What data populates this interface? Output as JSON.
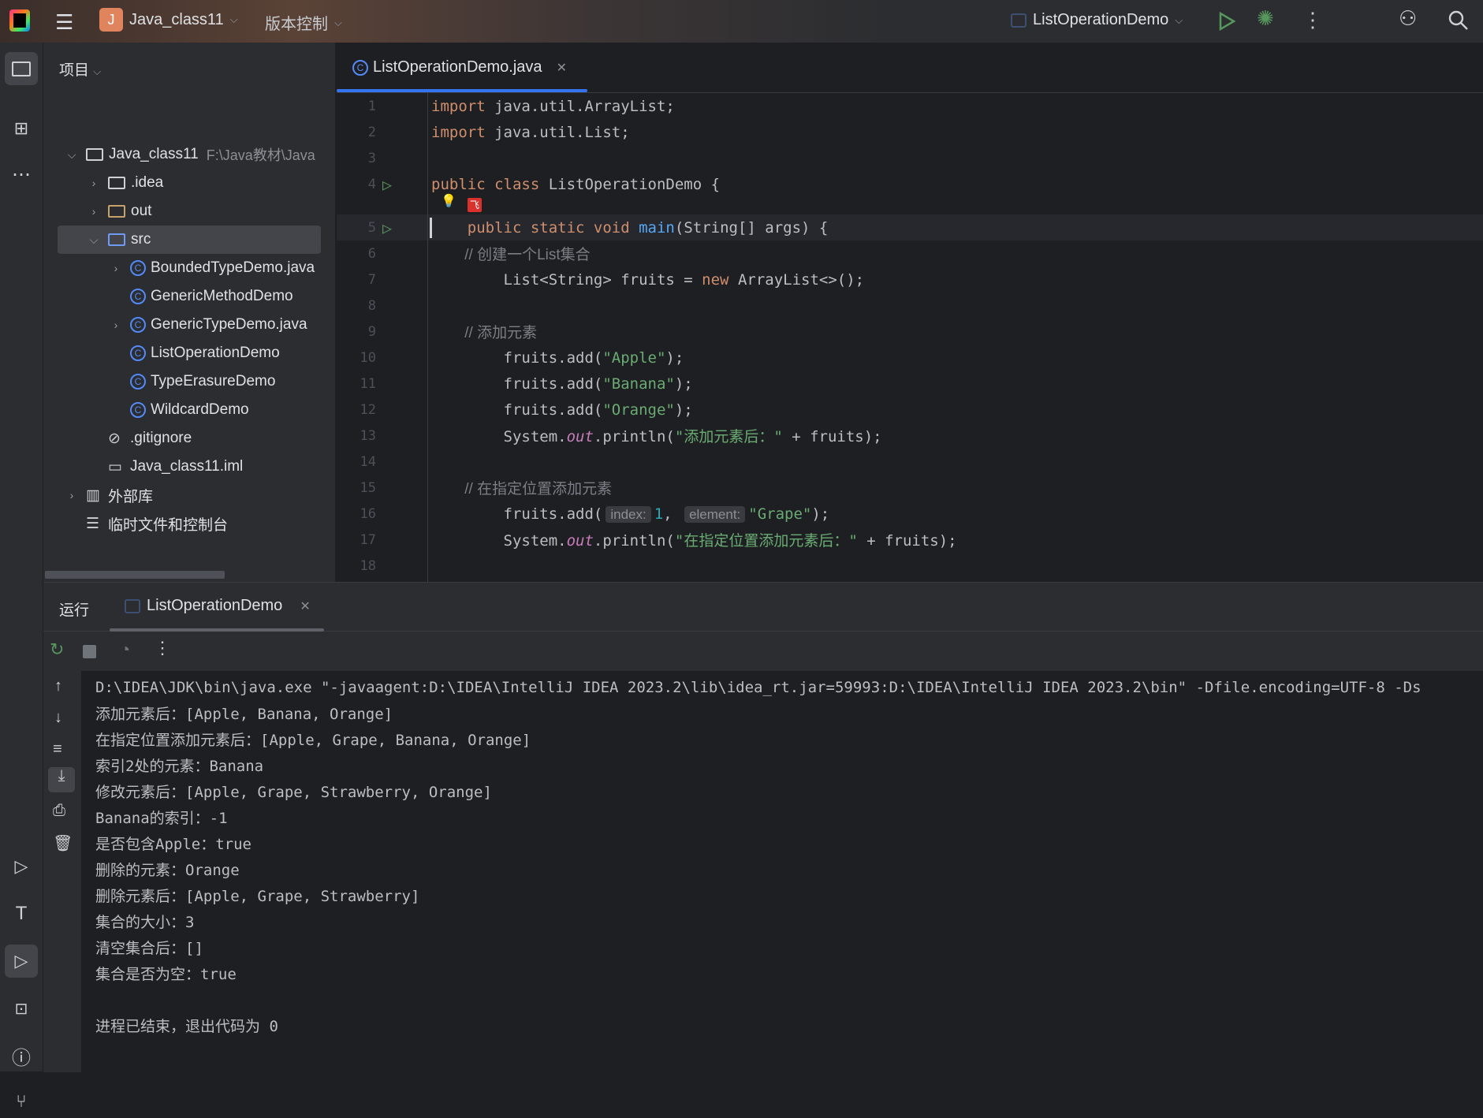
{
  "titlebar": {
    "project": "Java_class11",
    "project_initial": "J",
    "vcs": "版本控制",
    "run_config": "ListOperationDemo",
    "accent": "#e0845e"
  },
  "project_panel": {
    "title": "项目",
    "items": [
      {
        "label": "Java_class11",
        "extra": "F:\\Java教材\\Java",
        "level": 0,
        "arrow": "v",
        "icon": "module-folder"
      },
      {
        "label": ".idea",
        "level": 1,
        "arrow": ">",
        "icon": "folder"
      },
      {
        "label": "out",
        "level": 1,
        "arrow": ">",
        "icon": "folder-orange"
      },
      {
        "label": "src",
        "level": 1,
        "arrow": "v",
        "icon": "folder-blue",
        "selected": true
      },
      {
        "label": "BoundedTypeDemo.java",
        "level": 2,
        "arrow": ">",
        "icon": "class"
      },
      {
        "label": "GenericMethodDemo",
        "level": 2,
        "arrow": "",
        "icon": "class"
      },
      {
        "label": "GenericTypeDemo.java",
        "level": 2,
        "arrow": ">",
        "icon": "class"
      },
      {
        "label": "ListOperationDemo",
        "level": 2,
        "arrow": "",
        "icon": "class"
      },
      {
        "label": "TypeErasureDemo",
        "level": 2,
        "arrow": "",
        "icon": "class"
      },
      {
        "label": "WildcardDemo",
        "level": 2,
        "arrow": "",
        "icon": "class"
      },
      {
        "label": ".gitignore",
        "level": 1,
        "arrow": "",
        "icon": "ignore"
      },
      {
        "label": "Java_class11.iml",
        "level": 1,
        "arrow": "",
        "icon": "file"
      },
      {
        "label": "外部库",
        "level": 0,
        "arrow": ">",
        "icon": "library"
      },
      {
        "label": "临时文件和控制台",
        "level": 0,
        "arrow": "",
        "icon": "scratch"
      }
    ]
  },
  "editor": {
    "tab": "ListOperationDemo.java",
    "lines": [
      [
        [
          "import java.util.ArrayList;",
          "kw2"
        ]
      ],
      [
        [
          "import java.util.List;",
          "kw2"
        ]
      ],
      [],
      [
        [
          "public class ",
          "kw"
        ],
        [
          "ListOperationDemo {",
          ""
        ]
      ],
      [
        [
          "    public static void ",
          "kw"
        ],
        [
          "main",
          "fn"
        ],
        [
          "(String[] args) {",
          ""
        ]
      ],
      [
        [
          "        // 创建一个List集合",
          "cm"
        ]
      ],
      [
        [
          "        List<String> fruits = ",
          ""
        ],
        [
          "new ",
          "kw"
        ],
        [
          "ArrayList<>();",
          ""
        ]
      ],
      [],
      [
        [
          "        // 添加元素",
          "cm"
        ]
      ],
      [
        [
          "        fruits.add(",
          ""
        ],
        [
          "\"Apple\"",
          "str"
        ],
        [
          ");",
          ""
        ]
      ],
      [
        [
          "        fruits.add(",
          ""
        ],
        [
          "\"Banana\"",
          "str"
        ],
        [
          ");",
          ""
        ]
      ],
      [
        [
          "        fruits.add(",
          ""
        ],
        [
          "\"Orange\"",
          "str"
        ],
        [
          ");",
          ""
        ]
      ],
      [
        [
          "        System.",
          ""
        ],
        [
          "out",
          "st"
        ],
        [
          ".println(",
          ""
        ],
        [
          "\"添加元素后：\"",
          "str"
        ],
        [
          " + fruits);",
          ""
        ]
      ],
      [],
      [
        [
          "        // 在指定位置添加元素",
          "cm"
        ]
      ],
      [
        [
          "        fruits.add(",
          ""
        ],
        [
          "index:",
          "hint"
        ],
        [
          "1",
          "num"
        ],
        [
          ", ",
          ""
        ],
        [
          "element:",
          "hint"
        ],
        [
          "\"Grape\"",
          "str"
        ],
        [
          ");",
          ""
        ]
      ],
      [
        [
          "        System.",
          ""
        ],
        [
          "out",
          "st"
        ],
        [
          ".println(",
          ""
        ],
        [
          "\"在指定位置添加元素后：\"",
          "str"
        ],
        [
          " + fruits);",
          ""
        ]
      ],
      []
    ]
  },
  "run": {
    "title": "运行",
    "tab": "ListOperationDemo",
    "output": [
      "D:\\IDEA\\JDK\\bin\\java.exe \"-javaagent:D:\\IDEA\\IntelliJ IDEA 2023.2\\lib\\idea_rt.jar=59993:D:\\IDEA\\IntelliJ IDEA 2023.2\\bin\" -Dfile.encoding=UTF-8 -Ds",
      "添加元素后：[Apple, Banana, Orange]",
      "在指定位置添加元素后：[Apple, Grape, Banana, Orange]",
      "索引2处的元素：Banana",
      "修改元素后：[Apple, Grape, Strawberry, Orange]",
      "Banana的索引：-1",
      "是否包含Apple：true",
      "删除的元素：Orange",
      "删除元素后：[Apple, Grape, Strawberry]",
      "集合的大小：3",
      "清空集合后：[]",
      "集合是否为空：true",
      "",
      "进程已结束，退出代码为 0"
    ]
  }
}
